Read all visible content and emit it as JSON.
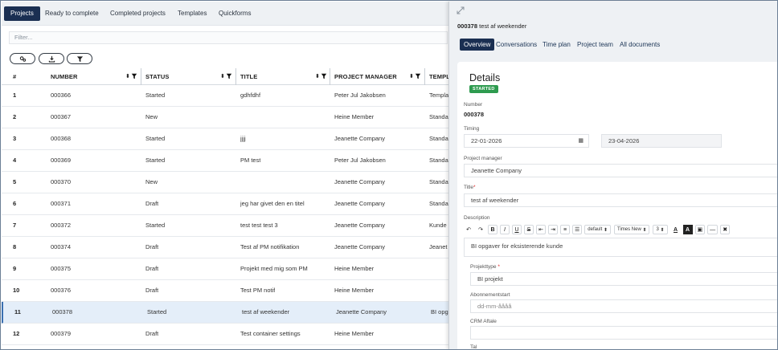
{
  "tabs": [
    {
      "label": "Projects",
      "active": true
    },
    {
      "label": "Ready to complete",
      "active": false
    },
    {
      "label": "Completed projects",
      "active": false
    },
    {
      "label": "Templates",
      "active": false
    },
    {
      "label": "Quickforms",
      "active": false
    }
  ],
  "filter": {
    "placeholder": "Filter..."
  },
  "toolbar": {
    "icons": [
      "settings-icon",
      "download-icon",
      "filter-icon"
    ]
  },
  "table": {
    "headers": [
      "#",
      "NUMBER",
      "STATUS",
      "TITLE",
      "PROJECT MANAGER",
      "TEMPL"
    ],
    "rows": [
      [
        "1",
        "000366",
        "Started",
        "gdhfdhf",
        "Peter Jul Jakobsen",
        "Templa"
      ],
      [
        "2",
        "000367",
        "New",
        "",
        "Heine Member",
        "Standa"
      ],
      [
        "3",
        "000368",
        "Started",
        "jjjj",
        "Jeanette Company",
        "Standa"
      ],
      [
        "4",
        "000369",
        "Started",
        "PM test",
        "Peter Jul Jakobsen",
        "Standa"
      ],
      [
        "5",
        "000370",
        "New",
        "",
        "Jeanette Company",
        "Standa"
      ],
      [
        "6",
        "000371",
        "Draft",
        "jeg har givet den en titel",
        "Jeanette Company",
        "Standa"
      ],
      [
        "7",
        "000372",
        "Started",
        "test test test 3",
        "Jeanette Company",
        "Kunde"
      ],
      [
        "8",
        "000374",
        "Draft",
        "Test af PM notifikation",
        "Jeanette Company",
        "Jeanet"
      ],
      [
        "9",
        "000375",
        "Draft",
        "Projekt med mig som PM",
        "Heine Member",
        ""
      ],
      [
        "10",
        "000376",
        "Draft",
        "Test PM notif",
        "Heine Member",
        ""
      ],
      [
        "11",
        "000378",
        "Started",
        "test af weekender",
        "Jeanette Company",
        "BI opga"
      ],
      [
        "12",
        "000379",
        "Draft",
        "Test container settings",
        "Heine Member",
        ""
      ]
    ],
    "selected_index": 10
  },
  "panel": {
    "number": "000378",
    "title": "test af weekender",
    "tabs": [
      "Overview",
      "Conversations",
      "Time plan",
      "Project team",
      "All documents"
    ],
    "details_title": "Details",
    "status_badge": "STARTED",
    "number_label": "Number",
    "timing_label": "Timing",
    "start_date": "22-01-2026",
    "end_date": "23-04-2026",
    "pm_label": "Project manager",
    "pm_value": "Jeanette Company",
    "title_label": "Title",
    "title_value": "test af weekender",
    "description_label": "Description",
    "editor": {
      "format": "default",
      "font": "Times New",
      "size": "3"
    },
    "description_value": "BI opgaver for eksisterende kunde",
    "projekttype_label": "Projekttype",
    "projekttype_value": "BI projekt",
    "abonnement_label": "Abonnementstart",
    "abonnement_placeholder": "dd-mm-åååå",
    "crm_label": "CRM Aftale",
    "tal_label": "Tal"
  },
  "colors": {
    "primary": "#1a2f52",
    "started_badge": "#2e9b4f",
    "selected_row": "#e4eef9"
  }
}
